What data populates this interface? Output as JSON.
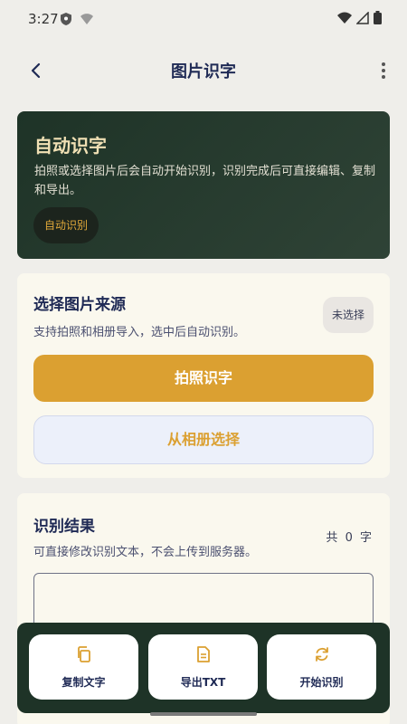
{
  "status_bar": {
    "time": "3:27"
  },
  "app_bar": {
    "title": "图片识字"
  },
  "hero": {
    "title": "自动识字",
    "description": "拍照或选择图片后会自动开始识别，识别完成后可直接编辑、复制和导出。",
    "chip": "自动识别"
  },
  "source": {
    "title": "选择图片来源",
    "subtitle": "支持拍照和相册导入，选中后自动识别。",
    "status": "未选择",
    "camera_button": "拍照识字",
    "album_button": "从相册选择"
  },
  "result": {
    "title": "识别结果",
    "subtitle": "可直接修改识别文本，不会上传到服务器。",
    "count_prefix": "共",
    "count_value": "0",
    "count_suffix": "字",
    "text_value": ""
  },
  "actions": [
    {
      "label": "复制文字",
      "icon": "copy-icon"
    },
    {
      "label": "导出TXT",
      "icon": "document-icon"
    },
    {
      "label": "开始识别",
      "icon": "refresh-icon"
    }
  ],
  "colors": {
    "accent": "#dba031",
    "dark_green": "#1e3327",
    "title_navy": "#1f2a55",
    "card_bg": "#faf8ee"
  }
}
